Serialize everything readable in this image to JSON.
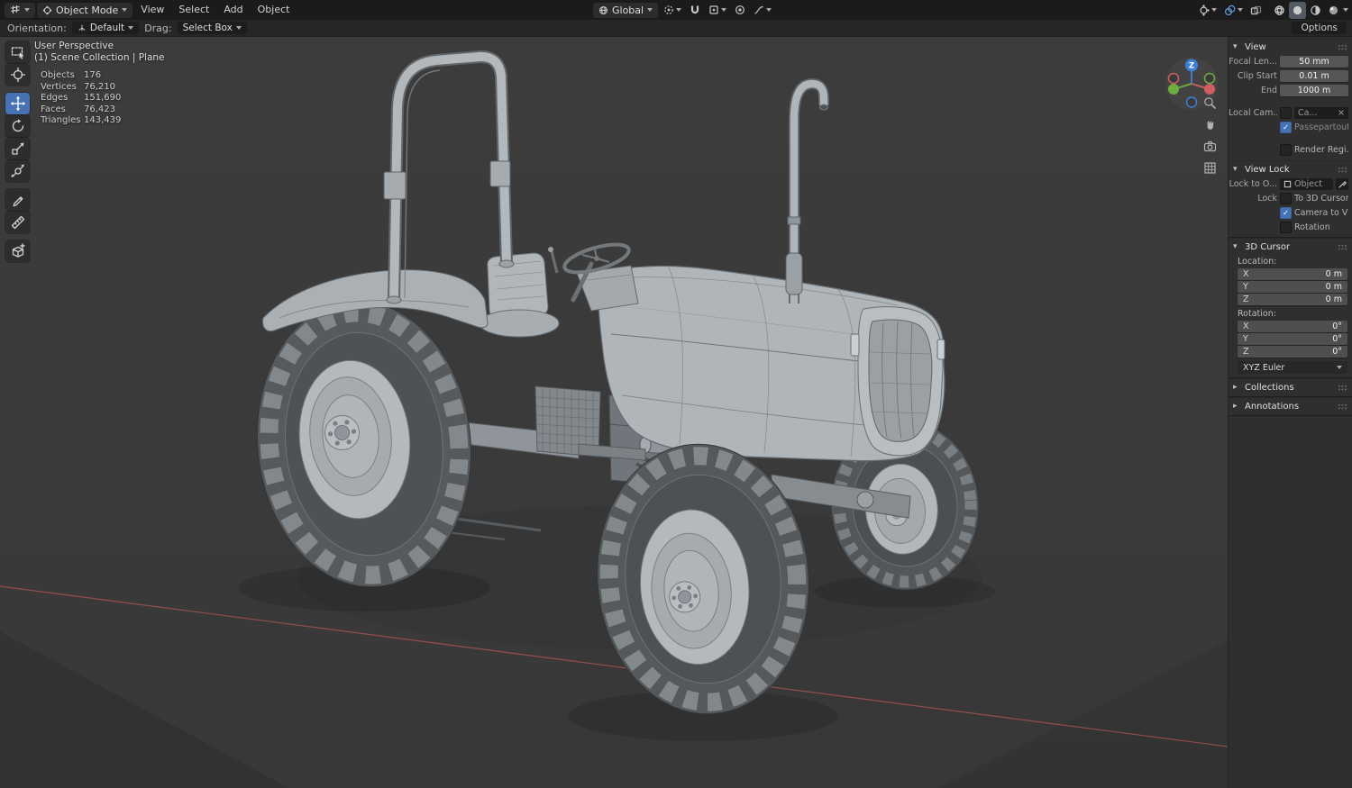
{
  "topbar": {
    "mode_label": "Object Mode",
    "menu_view": "View",
    "menu_select": "Select",
    "menu_add": "Add",
    "menu_object": "Object",
    "orientation_label": "Global",
    "right_icon_names": [
      "show-gizmo-icon",
      "show-overlays-icon",
      "toggle-xray-icon",
      "shading-wireframe-icon",
      "shading-solid-icon",
      "shading-material-icon",
      "shading-rendered-icon"
    ]
  },
  "tool_header": {
    "orientation_label": "Orientation:",
    "orientation_value": "Default",
    "drag_label": "Drag:",
    "drag_value": "Select Box",
    "options_label": "Options"
  },
  "toolbar": {
    "active_tool": "move",
    "tools": [
      "select-box",
      "cursor",
      "move",
      "rotate",
      "scale",
      "transform",
      "annotate",
      "measure",
      "add-cube"
    ]
  },
  "viewport": {
    "perspective_label": "User Perspective",
    "breadcrumb": "(1) Scene Collection | Plane",
    "stats": [
      {
        "label": "Objects",
        "value": "176"
      },
      {
        "label": "Vertices",
        "value": "76,210"
      },
      {
        "label": "Edges",
        "value": "151,690"
      },
      {
        "label": "Faces",
        "value": "76,423"
      },
      {
        "label": "Triangles",
        "value": "143,439"
      }
    ],
    "gizmo_axis_label": "Z"
  },
  "sidebar": {
    "view": {
      "title": "View",
      "rows": {
        "focal": {
          "label": "Focal Len...",
          "value": "50 mm"
        },
        "clip_start": {
          "label": "Clip Start",
          "value": "0.01 m"
        },
        "clip_end": {
          "label": "End",
          "value": "1000 m"
        },
        "local_camera": {
          "label": "Local Cam...",
          "value": "Ca...",
          "checked": false
        },
        "passepartout": {
          "label": "Passepartout",
          "checked": true
        },
        "render_region": {
          "label": "Render Regi...",
          "checked": false
        }
      }
    },
    "view_lock": {
      "title": "View Lock",
      "lock_to_label": "Lock to O...",
      "lock_to_value": "Object",
      "lock_label": "Lock",
      "to_3d_cursor": "To 3D Cursor",
      "camera_to_view": "Camera to Vi...",
      "camera_to_view_checked": true,
      "rotation": "Rotation",
      "rotation_checked": false
    },
    "cursor3d": {
      "title": "3D Cursor",
      "location_label": "Location:",
      "rotation_label": "Rotation:",
      "location": [
        {
          "axis": "X",
          "value": "0 m"
        },
        {
          "axis": "Y",
          "value": "0 m"
        },
        {
          "axis": "Z",
          "value": "0 m"
        }
      ],
      "rotation": [
        {
          "axis": "X",
          "value": "0°"
        },
        {
          "axis": "Y",
          "value": "0°"
        },
        {
          "axis": "Z",
          "value": "0°"
        }
      ],
      "euler_mode": "XYZ Euler"
    },
    "collections_title": "Collections",
    "annotations_title": "Annotations"
  },
  "colors": {
    "accent": "#4772b3",
    "axis_x": "#cf5f5f",
    "axis_y": "#6fae3e",
    "axis_z": "#3d7fd4",
    "viewport_bg": "#3a3a3a"
  }
}
